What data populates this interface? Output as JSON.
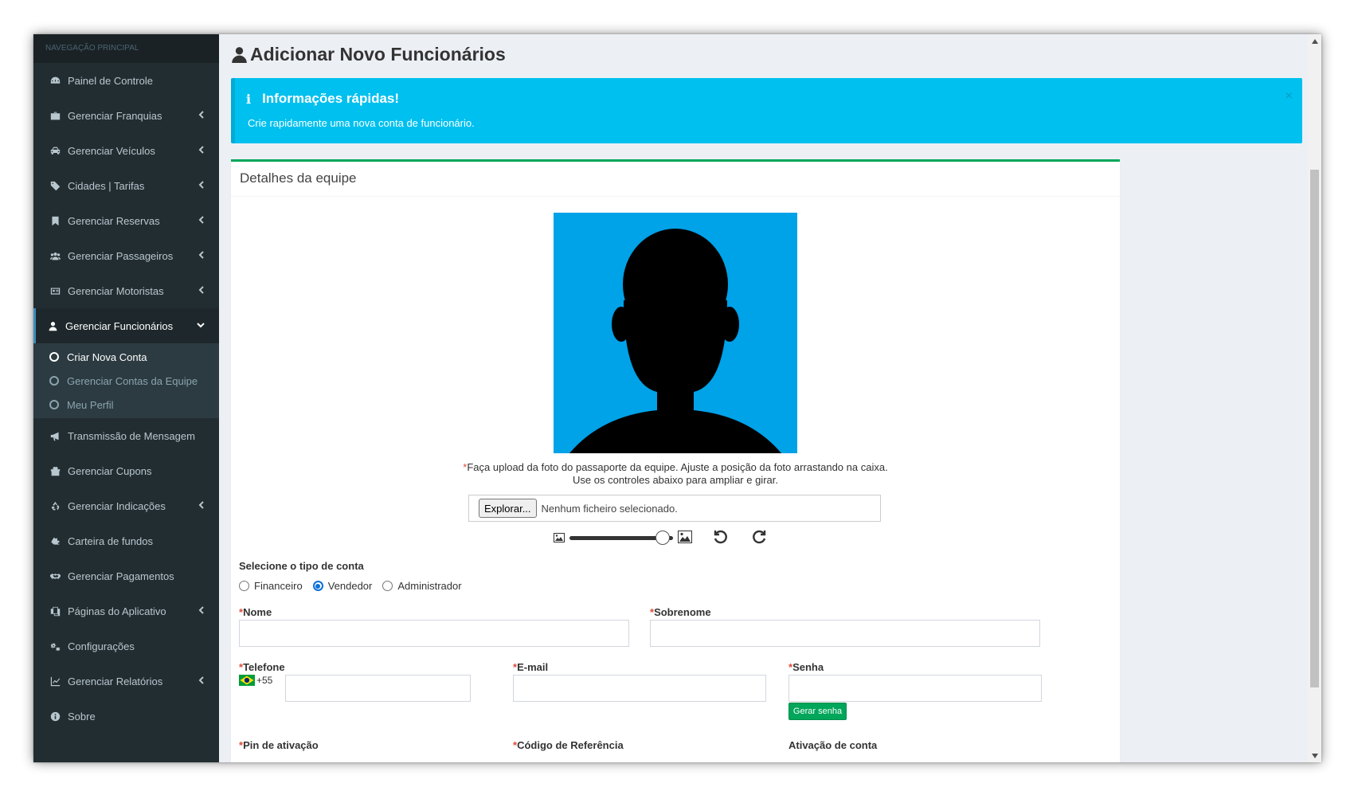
{
  "sidebar": {
    "header": "NAVEGAÇÃO PRINCIPAL",
    "items": [
      {
        "label": "Painel de Controle",
        "icon": "dashboard-icon"
      },
      {
        "label": "Gerenciar Franquias",
        "icon": "briefcase-icon"
      },
      {
        "label": "Gerenciar Veículos",
        "icon": "car-icon"
      },
      {
        "label": "Cidades | Tarifas",
        "icon": "tags-icon"
      },
      {
        "label": "Gerenciar Reservas",
        "icon": "bookmark-icon"
      },
      {
        "label": "Gerenciar Passageiros",
        "icon": "users-icon"
      },
      {
        "label": "Gerenciar Motoristas",
        "icon": "id-card-icon"
      },
      {
        "label": "Gerenciar Funcionários",
        "icon": "user-icon"
      },
      {
        "label": "Transmissão de Mensagem",
        "icon": "bullhorn-icon"
      },
      {
        "label": "Gerenciar Cupons",
        "icon": "gift-icon"
      },
      {
        "label": "Gerenciar Indicações",
        "icon": "recycle-icon"
      },
      {
        "label": "Carteira de fundos",
        "icon": "wallet-icon"
      },
      {
        "label": "Gerenciar Pagamentos",
        "icon": "handshake-icon"
      },
      {
        "label": "Páginas do Aplicativo",
        "icon": "copy-icon"
      },
      {
        "label": "Configurações",
        "icon": "cogs-icon"
      },
      {
        "label": "Gerenciar Relatórios",
        "icon": "line-chart-icon"
      },
      {
        "label": "Sobre",
        "icon": "info-circle-icon"
      }
    ],
    "submenu": [
      {
        "label": "Criar Nova Conta"
      },
      {
        "label": "Gerenciar Contas da Equipe"
      },
      {
        "label": "Meu Perfil"
      }
    ]
  },
  "page": {
    "title": "Adicionar Novo Funcionários"
  },
  "callout": {
    "title": "Informações rápidas!",
    "text": "Crie rapidamente uma nova conta de funcionário.",
    "close": "×"
  },
  "box": {
    "title": "Detalhes da equipe",
    "upload_note": "Faça upload da foto do passaporte da equipe. Ajuste a posição da foto arrastando na caixa. Use os controles abaixo para ampliar e girar.",
    "file_button": "Explorar...",
    "file_status": "Nenhum ficheiro selecionado.",
    "zoom_level": 0.9,
    "account_type_label": "Selecione o tipo de conta",
    "account_types": [
      "Financeiro",
      "Vendedor",
      "Administrador"
    ],
    "selected_account_type": "Vendedor",
    "required_marker": "*",
    "fields": {
      "first_name": {
        "label": "Nome",
        "value": ""
      },
      "last_name": {
        "label": "Sobrenome",
        "value": ""
      },
      "phone": {
        "label": "Telefone",
        "prefix": "+55",
        "value": ""
      },
      "email": {
        "label": "E-mail",
        "value": ""
      },
      "password": {
        "label": "Senha",
        "value": ""
      },
      "pin": {
        "label": "Pin de ativação"
      },
      "referral": {
        "label": "Código de Referência"
      },
      "activation": {
        "label": "Ativação de conta"
      }
    },
    "generate_password_button": "Gerar senha"
  },
  "colors": {
    "sidebar_bg": "#222d32",
    "callout_bg": "#00c0ef",
    "box_border": "#00a65a",
    "photo_bg": "#00a2e8",
    "required": "#dd4b39",
    "generate_button": "#00a65a"
  }
}
